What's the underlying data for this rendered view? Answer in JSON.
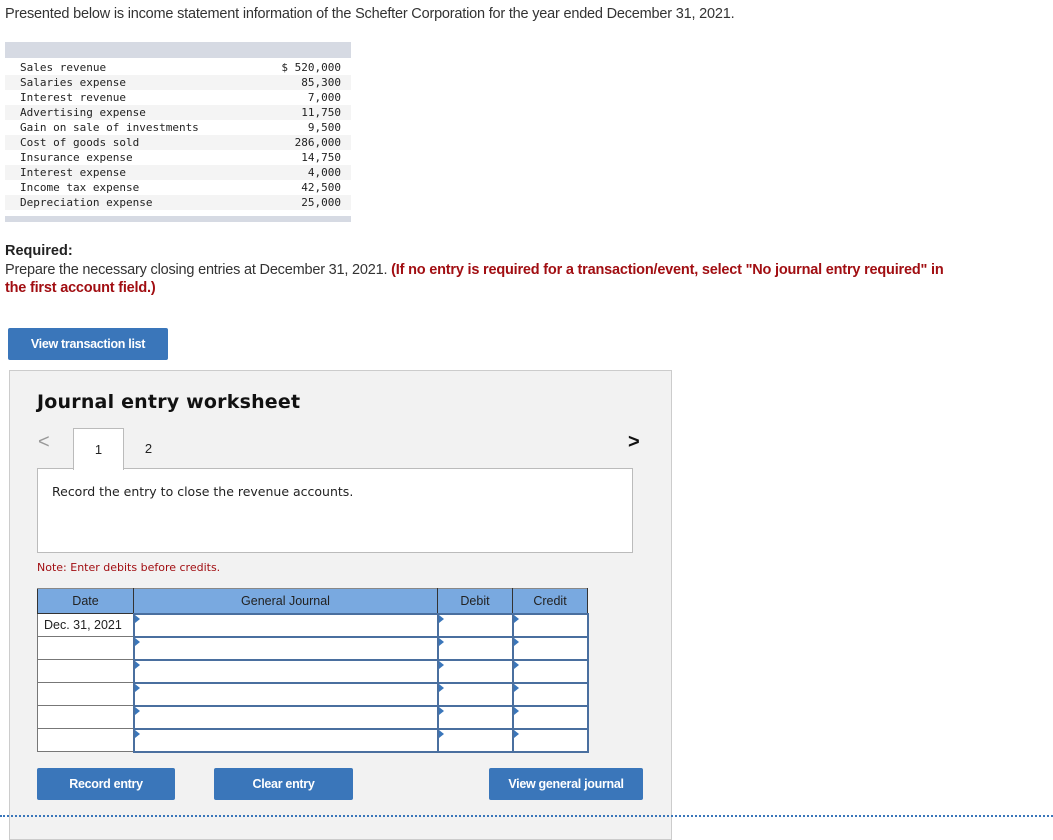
{
  "intro": "Presented below is income statement information of the Schefter Corporation for the year ended December 31, 2021.",
  "statement": [
    {
      "label": "Sales revenue",
      "amount": "$ 520,000"
    },
    {
      "label": "Salaries expense",
      "amount": "85,300"
    },
    {
      "label": "Interest revenue",
      "amount": "7,000"
    },
    {
      "label": "Advertising expense",
      "amount": "11,750"
    },
    {
      "label": "Gain on sale of investments",
      "amount": "9,500"
    },
    {
      "label": "Cost of goods sold",
      "amount": "286,000"
    },
    {
      "label": "Insurance expense",
      "amount": "14,750"
    },
    {
      "label": "Interest expense",
      "amount": "4,000"
    },
    {
      "label": "Income tax expense",
      "amount": "42,500"
    },
    {
      "label": "Depreciation expense",
      "amount": "25,000"
    }
  ],
  "required": {
    "label": "Required:",
    "text": "Prepare the necessary closing entries at December 31, 2021. ",
    "instruction": "(If no entry is required for a transaction/event, select \"No journal entry required\" in the first account field.)"
  },
  "buttons": {
    "view_transaction_list": "View transaction list",
    "record_entry": "Record entry",
    "clear_entry": "Clear entry",
    "view_general_journal": "View general journal"
  },
  "worksheet": {
    "title": "Journal entry worksheet",
    "nav_prev": "<",
    "nav_next": ">",
    "tabs": [
      {
        "label": "1",
        "active": true
      },
      {
        "label": "2",
        "active": false
      }
    ],
    "instruction": "Record the entry to close the revenue accounts.",
    "note": "Note: Enter debits before credits.",
    "table": {
      "headers": [
        "Date",
        "General Journal",
        "Debit",
        "Credit"
      ],
      "rows": [
        {
          "date": "Dec. 31, 2021",
          "account": "",
          "debit": "",
          "credit": ""
        },
        {
          "date": "",
          "account": "",
          "debit": "",
          "credit": ""
        },
        {
          "date": "",
          "account": "",
          "debit": "",
          "credit": ""
        },
        {
          "date": "",
          "account": "",
          "debit": "",
          "credit": ""
        },
        {
          "date": "",
          "account": "",
          "debit": "",
          "credit": ""
        },
        {
          "date": "",
          "account": "",
          "debit": "",
          "credit": ""
        }
      ]
    }
  },
  "colors": {
    "button_blue": "#3a76ba",
    "header_blue": "#79a9e0",
    "warning_red": "#a10e12"
  }
}
